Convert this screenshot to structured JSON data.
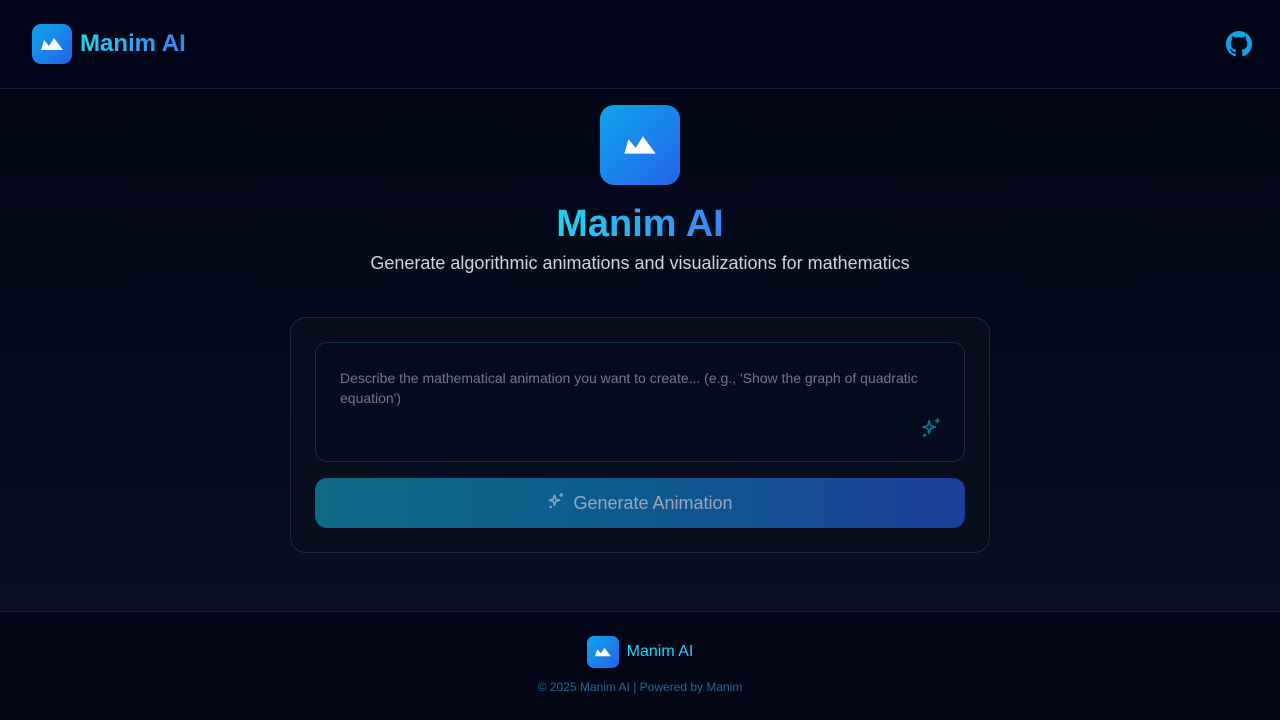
{
  "header": {
    "brand_name": "Manim AI",
    "logo_icon": "mountain-logo-icon",
    "github_icon": "github-icon"
  },
  "hero": {
    "title": "Manim AI",
    "subtitle": "Generate algorithmic animations and visualizations for mathematics"
  },
  "prompt": {
    "placeholder": "Describe the mathematical animation you want to create... (e.g., 'Show the graph of quadratic equation')",
    "value": "",
    "icon": "sparkles-icon"
  },
  "generate_button": {
    "label": "Generate Animation",
    "icon": "sparkles-icon"
  },
  "footer": {
    "brand_name": "Manim AI",
    "copyright": "© 2025 Manim AI | Powered by Manim"
  },
  "colors": {
    "background": "#020617",
    "accent_cyan": "#22d3ee",
    "accent_blue": "#3b82f6"
  }
}
